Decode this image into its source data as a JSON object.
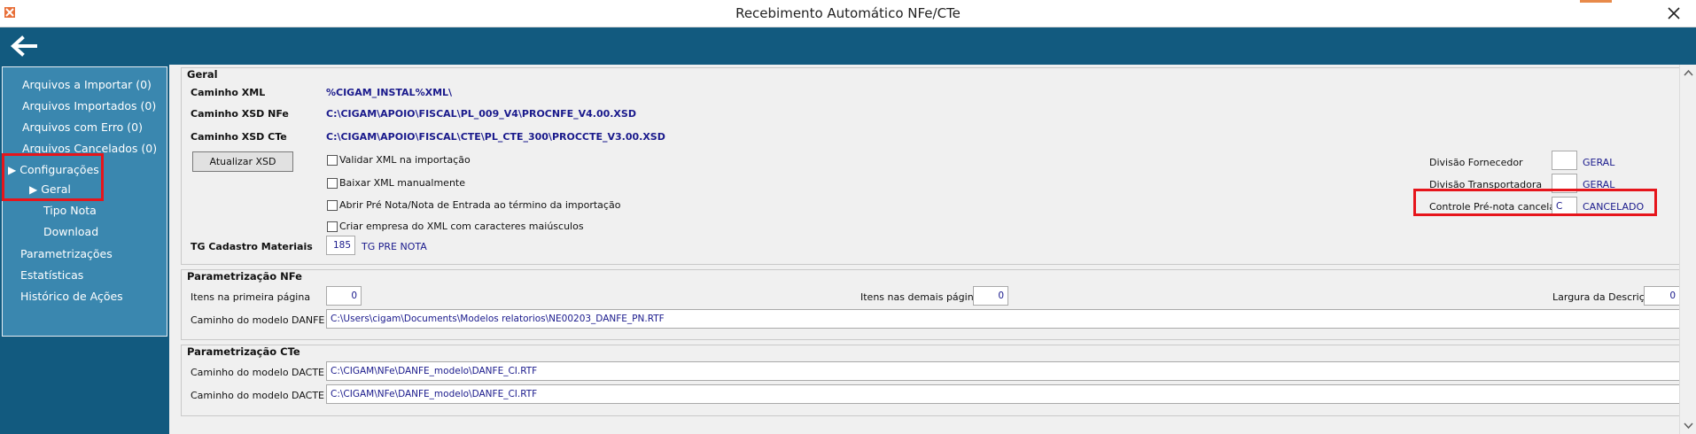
{
  "window": {
    "title": "Recebimento Automático NFe/CTe"
  },
  "sidebar": {
    "items": [
      {
        "label": "Arquivos a Importar (0)"
      },
      {
        "label": "Arquivos Importados (0)"
      },
      {
        "label": "Arquivos com Erro (0)"
      },
      {
        "label": "Arquivos Cancelados (0)"
      },
      {
        "label": "Configurações"
      },
      {
        "label": "Geral"
      },
      {
        "label": "Tipo Nota"
      },
      {
        "label": "Download"
      },
      {
        "label": "Parametrizações"
      },
      {
        "label": "Estatísticas"
      },
      {
        "label": "Histórico de Ações"
      }
    ]
  },
  "geral": {
    "title": "Geral",
    "xml_label": "Caminho XML",
    "xml_value": "%CIGAM_INSTAL%XML\\",
    "xsd_nfe_label": "Caminho XSD NFe",
    "xsd_nfe_value": "C:\\CIGAM\\APOIO\\FISCAL\\PL_009_V4\\PROCNFE_V4.00.XSD",
    "xsd_cte_label": "Caminho XSD CTe",
    "xsd_cte_value": "C:\\CIGAM\\APOIO\\FISCAL\\CTE\\PL_CTE_300\\PROCCTE_V3.00.XSD",
    "update_xsd_button": "Atualizar XSD",
    "checkbox_validate": "Validar XML na importação",
    "checkbox_download": "Baixar XML manualmente",
    "checkbox_open_pre": "Abrir Pré Nota/Nota de Entrada ao término da importação",
    "checkbox_create_company": "Criar empresa do XML com caracteres maiúsculos",
    "tg_label": "TG Cadastro Materiais",
    "tg_value": "185",
    "tg_desc": "TG PRE NOTA",
    "div_fornecedor_label": "Divisão Fornecedor",
    "div_fornecedor_value": "",
    "div_fornecedor_desc": "GERAL",
    "div_transportadora_label": "Divisão Transportadora",
    "div_transportadora_value": "",
    "div_transportadora_desc": "GERAL",
    "controle_label": "Controle Pré-nota cancelada",
    "controle_value": "C",
    "controle_desc": "CANCELADO"
  },
  "nfe": {
    "title": "Parametrização NFe",
    "items_first_label": "Itens na primeira página",
    "items_first_value": "0",
    "items_other_label": "Itens nas demais páginas",
    "items_other_value": "0",
    "desc_width_label": "Largura da Descrição",
    "desc_width_value": "0",
    "danfe_label": "Caminho do modelo DANFE",
    "danfe_value": "C:\\Users\\cigam\\Documents\\Modelos relatorios\\NE00203_DANFE_PN.RTF"
  },
  "cte": {
    "title": "Parametrização CTe",
    "dacte_label": "Caminho do modelo DACTE",
    "dacte_value": "C:\\CIGAM\\NFe\\DANFE_modelo\\DANFE_CI.RTF",
    "dacte_os_label": "Caminho do modelo DACTE OS",
    "dacte_os_value": "C:\\CIGAM\\NFe\\DANFE_modelo\\DANFE_CI.RTF"
  },
  "colors": {
    "toolbar": "#125a7f",
    "nav_panel": "#3a87af",
    "highlight": "#e6151b",
    "value_text": "#1a1a8c"
  },
  "icons": {
    "app": "app-logo-icon",
    "back": "back-arrow-icon",
    "close": "close-icon",
    "tree_expand": "triangle-right-icon"
  }
}
